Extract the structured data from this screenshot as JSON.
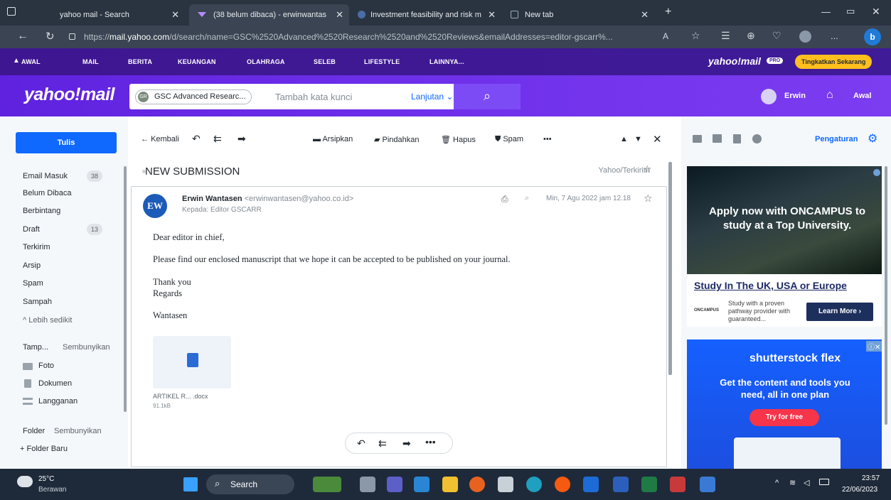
{
  "browser": {
    "tabs": [
      {
        "label": "yahoo mail - Search"
      },
      {
        "label": "(38 belum dibaca) - erwinwantas"
      },
      {
        "label": "Investment feasibility and risk m"
      },
      {
        "label": "New tab"
      }
    ],
    "url_prefix": "https://",
    "url_host": "mail.yahoo.com",
    "url_path": "/d/search/name=GSC%2520Advanced%2520Research%2520and%2520Reviews&emailAddresses=editor-gscarr%...",
    "more": "..."
  },
  "topnav": {
    "items": [
      "AWAL",
      "MAIL",
      "BERITA",
      "KEUANGAN",
      "OLAHRAGA",
      "SELEB",
      "LIFESTYLE",
      "LAINNYA..."
    ],
    "brand": "yahoo!mail",
    "pro": "PRO",
    "upgrade": "Tingkatkan Sekarang"
  },
  "header": {
    "logo": "yahoo!mail",
    "chip_avatar": "GR",
    "chip_label": "GSC Advanced Researc...",
    "keyword_placeholder": "Tambah kata kunci",
    "advanced": "Lanjutan",
    "user": "Erwin",
    "home": "Awal"
  },
  "sidebar": {
    "compose": "Tulis",
    "folders": [
      {
        "label": "Email Masuk",
        "count": "38"
      },
      {
        "label": "Belum Dibaca",
        "count": ""
      },
      {
        "label": "Berbintang",
        "count": ""
      },
      {
        "label": "Draft",
        "count": "13"
      },
      {
        "label": "Terkirim",
        "count": ""
      },
      {
        "label": "Arsip",
        "count": ""
      },
      {
        "label": "Spam",
        "count": ""
      },
      {
        "label": "Sampah",
        "count": ""
      }
    ],
    "less": "Lebih sedikit",
    "views_title": "Tamp...",
    "views_hide": "Sembunyikan",
    "views": [
      "Foto",
      "Dokumen",
      "Langganan"
    ],
    "folder_title": "Folder",
    "folder_hide": "Sembunyikan",
    "new_folder": "+ Folder Baru"
  },
  "toolbar": {
    "back": "Kembali",
    "archive": "Arsipkan",
    "move": "Pindahkan",
    "delete": "Hapus",
    "spam": "Spam",
    "more": "•••"
  },
  "message": {
    "subject": "NEW SUBMISSION",
    "folder": "Yahoo/Terkirim",
    "avatar": "EW",
    "sender_name": "Erwin Wantasen",
    "sender_addr": "<erwinwantasen@yahoo.co.id>",
    "to": "Kepada: Editor GSCARR",
    "date": "Min, 7 Agu 2022 jam 12.18",
    "body": [
      "Dear editor in chief,",
      "Please find our enclosed manuscript that we hope it can be accepted to be published on your journal.",
      "Thank you",
      "Regards",
      "Wantasen"
    ],
    "attachment_name": "ARTIKEL R... .docx",
    "attachment_size": "91.1kB"
  },
  "rail": {
    "settings": "Pengaturan",
    "ad1_headline": "Apply now with ONCAMPUS to study at a Top University.",
    "ad1_title": "Study In The UK, USA or Europe",
    "ad1_brand": "ONCAMPUS",
    "ad1_text": "Study with a proven pathway provider with guaranteed...",
    "ad1_cta": "Learn More",
    "ad2_brand": "shutterstock flex",
    "ad2_text": "Get the content and tools you need, all in one plan",
    "ad2_cta": "Try for free"
  },
  "taskbar": {
    "temp": "25°C",
    "weather": "Berawan",
    "search": "Search",
    "time": "23:57",
    "date": "22/06/2023"
  },
  "colors": {
    "purple": "#6001d2",
    "blue": "#0f69ff",
    "upgrade": "#ffc01e"
  }
}
